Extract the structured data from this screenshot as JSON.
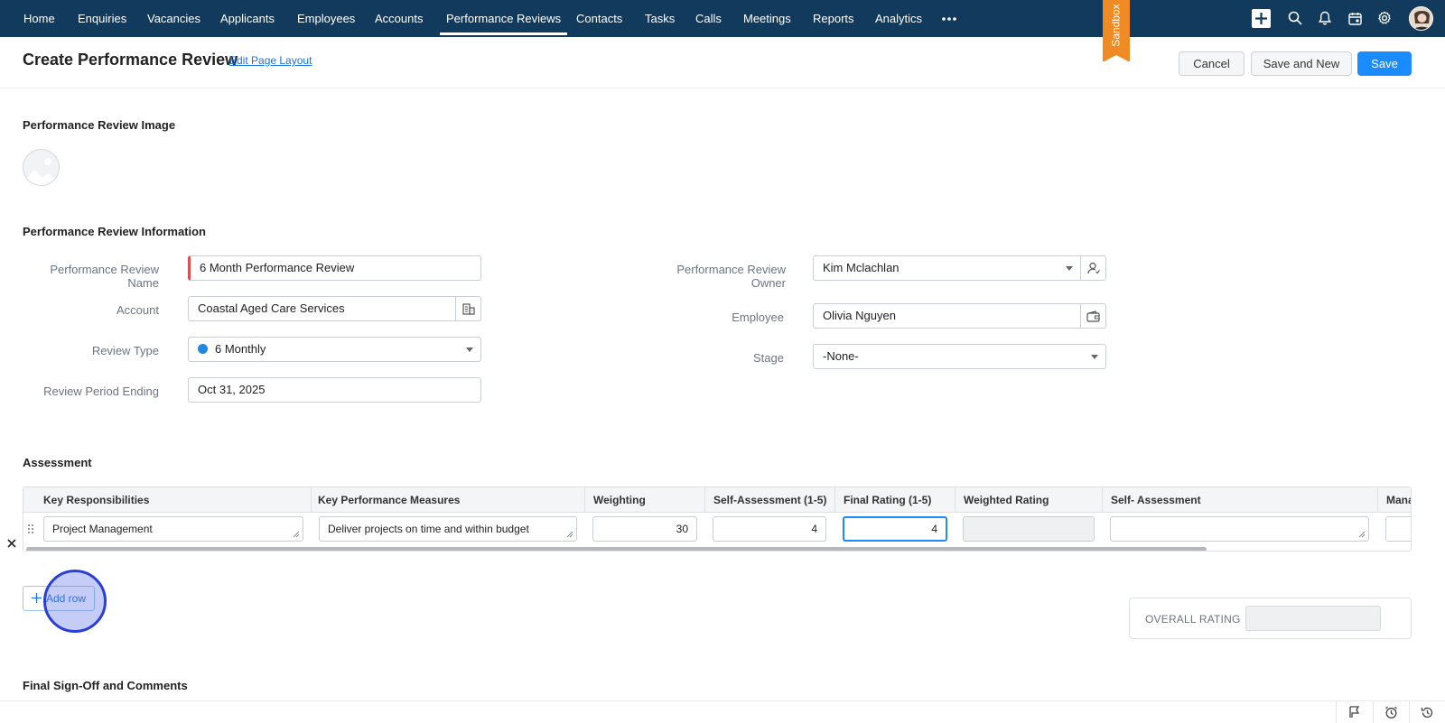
{
  "nav": {
    "items": [
      "Home",
      "Enquiries",
      "Vacancies",
      "Applicants",
      "Employees",
      "Accounts",
      "Performance Reviews",
      "Contacts",
      "Tasks",
      "Calls",
      "Meetings",
      "Reports",
      "Analytics"
    ],
    "active": "Performance Reviews",
    "sandbox_label": "Sandbox",
    "icons": [
      "more-icon",
      "create-icon",
      "search-icon",
      "bell-icon",
      "calendar-icon",
      "gear-icon",
      "avatar"
    ]
  },
  "header": {
    "title": "Create Performance Review",
    "edit_layout": "Edit Page Layout",
    "cancel": "Cancel",
    "save_and_new": "Save and New",
    "save": "Save"
  },
  "image_section": {
    "title": "Performance Review Image"
  },
  "info": {
    "title": "Performance Review Information",
    "name_label": "Performance Review Name",
    "name_value": "6 Month Performance Review",
    "account_label": "Account",
    "account_value": "Coastal Aged Care Services",
    "review_type_label": "Review Type",
    "review_type_value": "6 Monthly",
    "period_label": "Review Period Ending",
    "period_value": "Oct 31, 2025",
    "owner_label_1": "Performance Review",
    "owner_label_2": "Owner",
    "owner_value": "Kim Mclachlan",
    "employee_label": "Employee",
    "employee_value": "Olivia Nguyen",
    "stage_label": "Stage",
    "stage_value": "-None-"
  },
  "assessment": {
    "title": "Assessment",
    "columns": [
      "Key Responsibilities",
      "Key Performance Measures",
      "Weighting",
      "Self-Assessment (1-5)",
      "Final Rating (1-5)",
      "Weighted Rating",
      "Self- Assessment",
      "Mana"
    ],
    "row": {
      "responsibility": "Project Management",
      "measure": "Deliver projects on time and within budget",
      "weighting": "30",
      "self_assessment": "4",
      "final_rating": "4",
      "weighted_rating": "",
      "self_assessment_text": ""
    },
    "add_row": "Add row",
    "overall_label": "OVERALL RATING",
    "overall_value": ""
  },
  "signoff": {
    "title": "Final Sign-Off and Comments"
  },
  "colors": {
    "nav_bg": "#113a5c",
    "primary": "#1a8cff",
    "sandbox": "#f08a24",
    "mandatory": "#e24c4c"
  }
}
